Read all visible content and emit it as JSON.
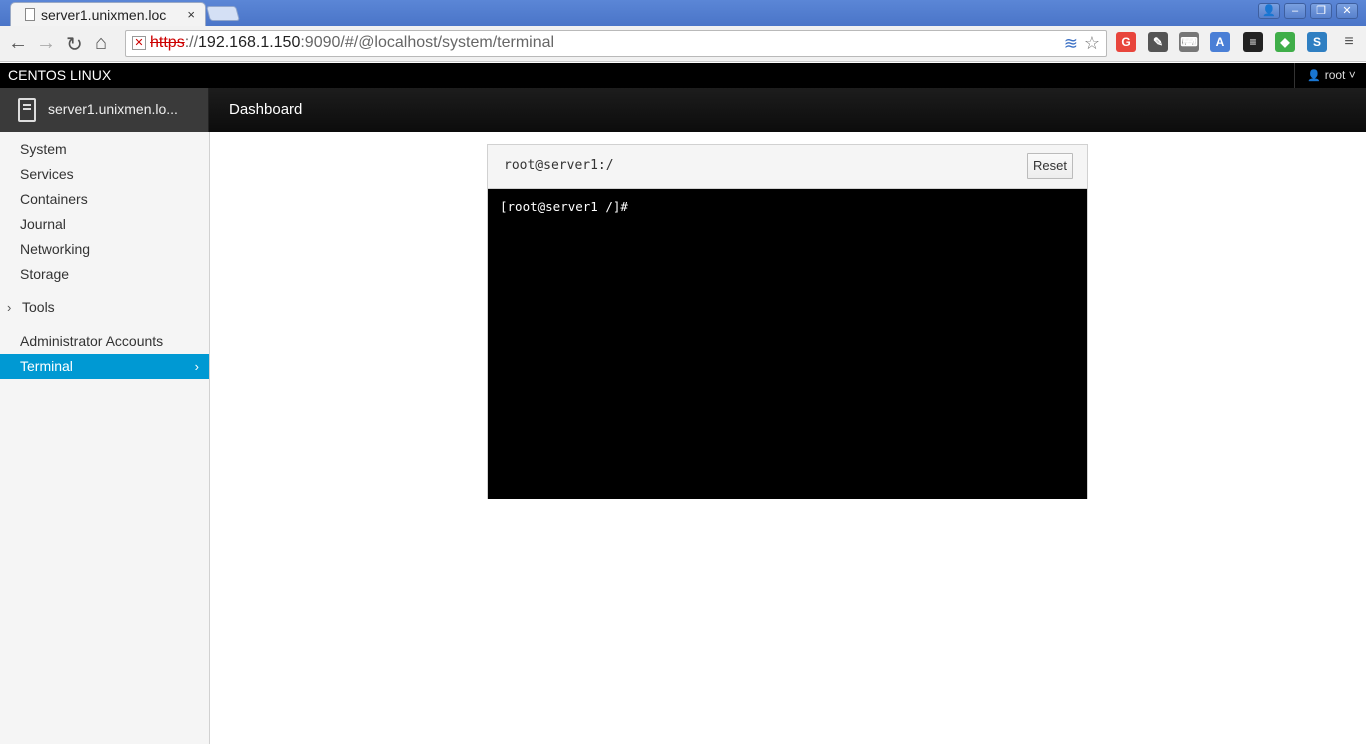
{
  "browser": {
    "tab_title": "server1.unixmen.loc",
    "tab_close": "×",
    "window_buttons": [
      "👤",
      "–",
      "❐",
      "✕"
    ],
    "nav": {
      "back": "←",
      "forward": "→",
      "reload": "↻",
      "home": "⌂"
    },
    "url": {
      "scheme": "https",
      "separator": "://",
      "host": "192.168.1.150",
      "rest": ":9090/#/@localhost/system/terminal"
    },
    "extensions": [
      {
        "name": "google-icon",
        "color": "#e8453c"
      },
      {
        "name": "wrench-icon",
        "color": "#555555"
      },
      {
        "name": "keyboard-icon",
        "color": "#777777"
      },
      {
        "name": "translate-icon",
        "color": "#4a7fd6"
      },
      {
        "name": "buffer-icon",
        "color": "#222222"
      },
      {
        "name": "evernote-icon",
        "color": "#3fae49"
      },
      {
        "name": "tab-icon",
        "color": "#2f7fc2"
      },
      {
        "name": "menu-icon",
        "color": "#666666"
      }
    ]
  },
  "cockpit": {
    "brand": "CENTOS LINUX",
    "user": "root",
    "host_name": "server1.unixmen.lo...",
    "breadcrumb": "Dashboard",
    "accent_color": "#0099d3"
  },
  "sidebar": {
    "items": [
      {
        "label": "System"
      },
      {
        "label": "Services"
      },
      {
        "label": "Containers"
      },
      {
        "label": "Journal"
      },
      {
        "label": "Networking"
      },
      {
        "label": "Storage"
      }
    ],
    "tools_label": "Tools",
    "sub_items": [
      {
        "label": "Administrator Accounts"
      },
      {
        "label": "Terminal",
        "active": true
      }
    ]
  },
  "terminal": {
    "title": "root@server1:/",
    "reset_label": "Reset",
    "lines": [
      "[root@server1 /]#"
    ]
  }
}
